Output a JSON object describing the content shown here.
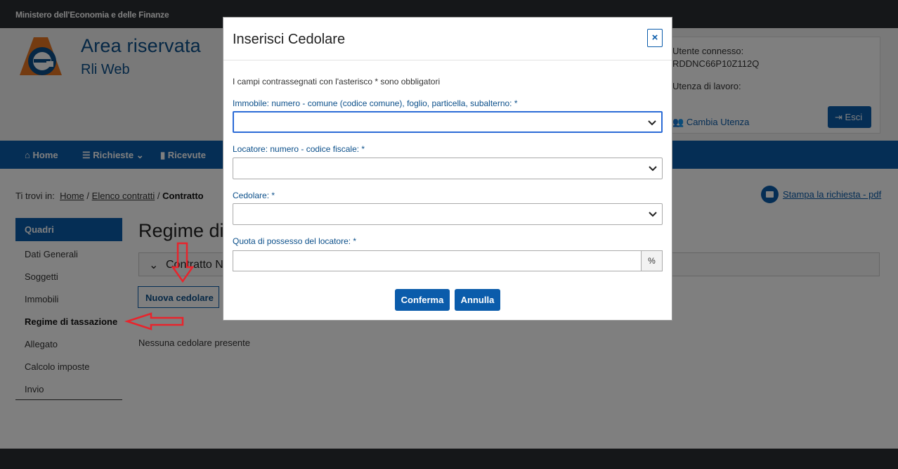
{
  "topbar": {
    "ministry": "Ministero dell'Economia e delle Finanze"
  },
  "brand": {
    "title": "Area riservata",
    "subtitle": "Rli Web"
  },
  "user": {
    "connected_label": "Utente connesso:",
    "fiscal_code": "RDDNC66P10Z112Q",
    "work_label": "Utenza di lavoro:",
    "change_label": "Cambia Utenza",
    "exit_label": "Esci"
  },
  "nav": {
    "home": "Home",
    "requests": "Richieste",
    "receipts": "Ricevute"
  },
  "breadcrumb": {
    "prefix": "Ti trovi in:",
    "home": "Home",
    "sep1": "/",
    "contracts": "Elenco contratti",
    "sep2": "/",
    "current": "Contratto"
  },
  "print_label": "Stampa la richiesta - pdf",
  "sidebar": {
    "header": "Quadri",
    "items": [
      "Dati Generali",
      "Soggetti",
      "Immobili",
      "Regime di tassazione",
      "Allegato",
      "Calcolo imposte",
      "Invio"
    ],
    "active_index": 3
  },
  "main": {
    "title": "Regime di",
    "accordion_label": "Contratto N",
    "new_button": "Nuova cedolare",
    "empty_text": "Nessuna cedolare presente"
  },
  "modal": {
    "title": "Inserisci Cedolare",
    "close_symbol": "×",
    "hint": "I campi contrassegnati con l'asterisco * sono obbligatori",
    "fields": {
      "property_label": "Immobile: numero - comune (codice comune), foglio, particella, subalterno: *",
      "landlord_label": "Locatore: numero - codice fiscale: *",
      "cedolare_label": "Cedolare: *",
      "share_label": "Quota di possesso del locatore: *",
      "share_addon": "%"
    },
    "confirm_label": "Conferma",
    "cancel_label": "Annulla"
  },
  "colors": {
    "primary": "#0b5cab",
    "dark": "#2b2f33",
    "annotation": "#e8242c"
  }
}
